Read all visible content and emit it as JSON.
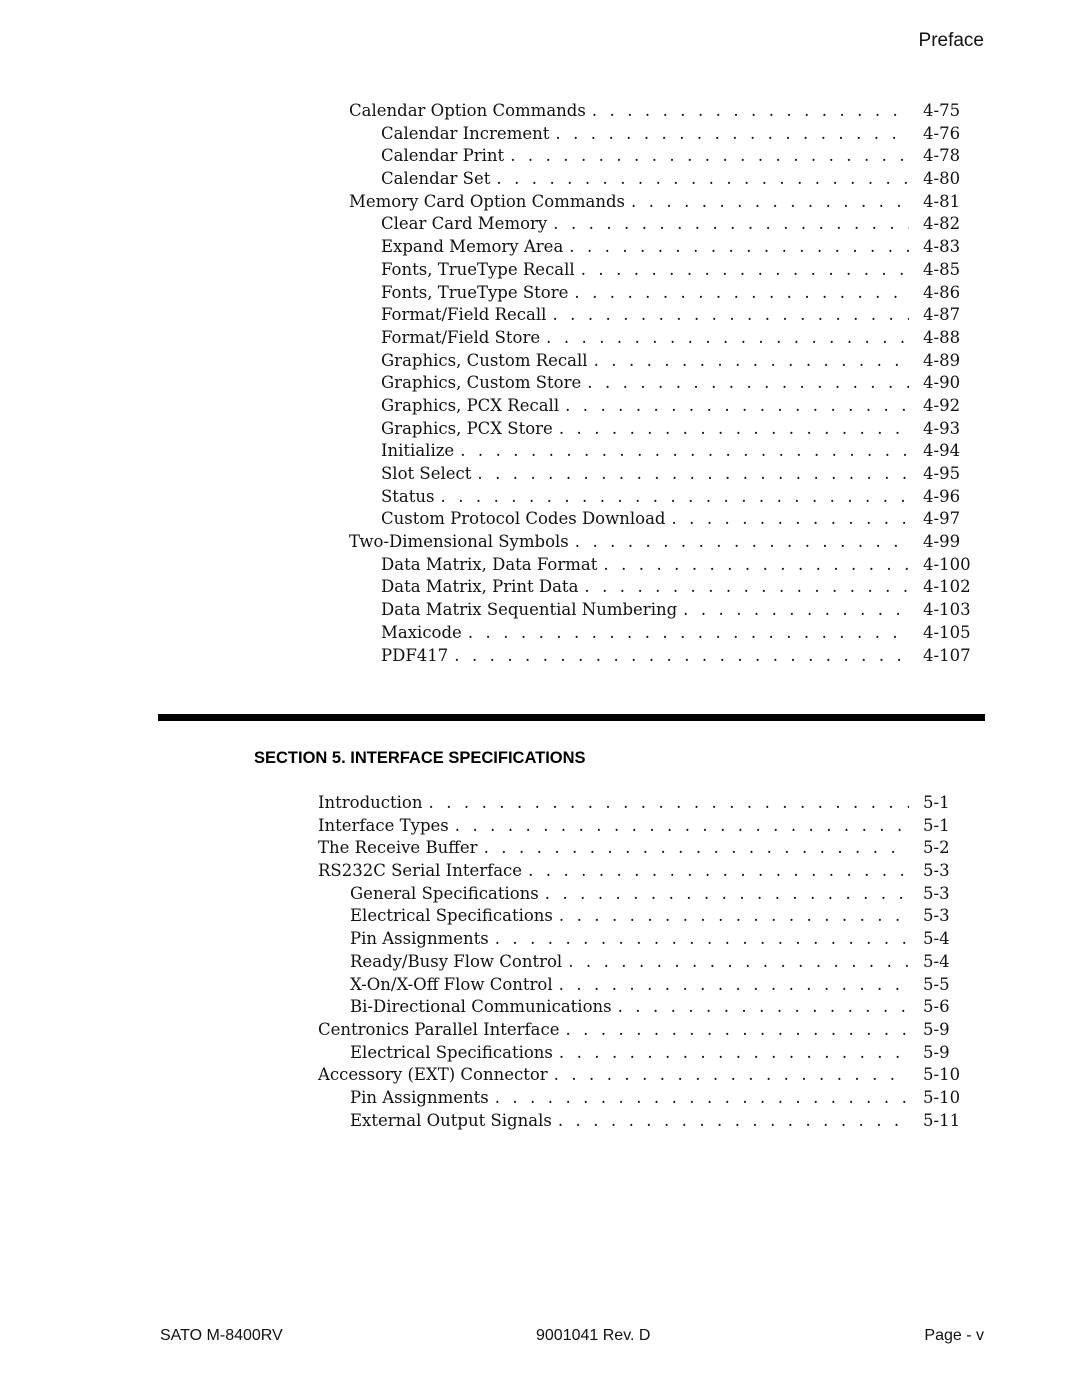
{
  "header": {
    "section_name": "Preface"
  },
  "toc_part1": [
    {
      "label": "Calendar Option Commands",
      "page": "4-75",
      "level": 1
    },
    {
      "label": "Calendar Increment",
      "page": "4-76",
      "level": 2
    },
    {
      "label": "Calendar Print",
      "page": "4-78",
      "level": 2
    },
    {
      "label": "Calendar Set",
      "page": "4-80",
      "level": 2
    },
    {
      "label": "Memory Card Option Commands",
      "page": "4-81",
      "level": 1
    },
    {
      "label": "Clear Card Memory",
      "page": "4-82",
      "level": 2
    },
    {
      "label": "Expand Memory Area",
      "page": "4-83",
      "level": 2
    },
    {
      "label": "Fonts, TrueType Recall",
      "page": "4-85",
      "level": 2
    },
    {
      "label": "Fonts, TrueType Store",
      "page": "4-86",
      "level": 2
    },
    {
      "label": "Format/Field Recall",
      "page": "4-87",
      "level": 2
    },
    {
      "label": "Format/Field Store",
      "page": "4-88",
      "level": 2
    },
    {
      "label": "Graphics, Custom Recall",
      "page": "4-89",
      "level": 2
    },
    {
      "label": "Graphics, Custom Store",
      "page": "4-90",
      "level": 2
    },
    {
      "label": "Graphics, PCX Recall",
      "page": "4-92",
      "level": 2
    },
    {
      "label": "Graphics, PCX Store",
      "page": "4-93",
      "level": 2
    },
    {
      "label": "Initialize",
      "page": "4-94",
      "level": 2
    },
    {
      "label": "Slot Select",
      "page": "4-95",
      "level": 2
    },
    {
      "label": "Status",
      "page": "4-96",
      "level": 2
    },
    {
      "label": "Custom Protocol Codes Download",
      "page": "4-97",
      "level": 2
    },
    {
      "label": "Two-Dimensional Symbols",
      "page": "4-99",
      "level": 1
    },
    {
      "label": "Data Matrix, Data Format",
      "page": "4-100",
      "level": 2
    },
    {
      "label": "Data Matrix, Print Data",
      "page": "4-102",
      "level": 2
    },
    {
      "label": "Data Matrix Sequential Numbering",
      "page": "4-103",
      "level": 2
    },
    {
      "label": "Maxicode",
      "page": "4-105",
      "level": 2
    },
    {
      "label": "PDF417",
      "page": "4-107",
      "level": 2
    }
  ],
  "section5": {
    "title": "SECTION 5. INTERFACE SPECIFICATIONS",
    "entries": [
      {
        "label": "Introduction",
        "page": "5-1",
        "level": 1
      },
      {
        "label": "Interface Types",
        "page": "5-1",
        "level": 1
      },
      {
        "label": "The Receive Buffer",
        "page": "5-2",
        "level": 1
      },
      {
        "label": "RS232C Serial Interface",
        "page": "5-3",
        "level": 1
      },
      {
        "label": "General Specifications",
        "page": "5-3",
        "level": 2
      },
      {
        "label": "Electrical Specifications",
        "page": "5-3",
        "level": 2
      },
      {
        "label": "Pin Assignments",
        "page": "5-4",
        "level": 2
      },
      {
        "label": "Ready/Busy Flow Control",
        "page": "5-4",
        "level": 2
      },
      {
        "label": "X-On/X-Off Flow Control",
        "page": "5-5",
        "level": 2
      },
      {
        "label": "Bi-Directional Communications",
        "page": "5-6",
        "level": 2
      },
      {
        "label": "Centronics Parallel Interface",
        "page": "5-9",
        "level": 1
      },
      {
        "label": "Electrical Specifications",
        "page": "5-9",
        "level": 2
      },
      {
        "label": "Accessory (EXT) Connector",
        "page": "5-10",
        "level": 1
      },
      {
        "label": "Pin Assignments",
        "page": "5-10",
        "level": 2
      },
      {
        "label": "External Output Signals",
        "page": "5-11",
        "level": 2
      }
    ]
  },
  "footer": {
    "product": "SATO M-8400RV",
    "doc_number": "9001041 Rev. D",
    "page": "Page - v"
  }
}
